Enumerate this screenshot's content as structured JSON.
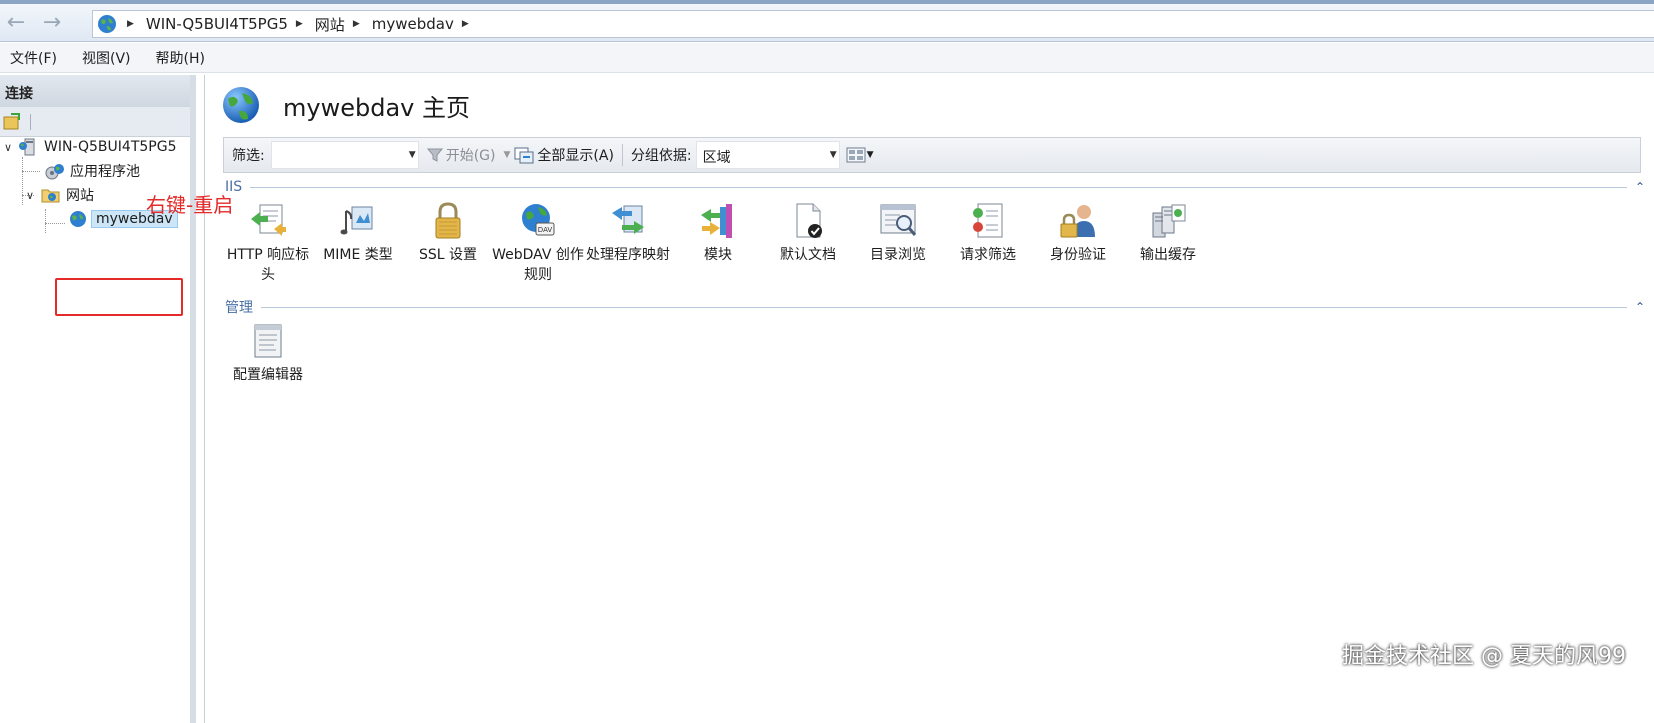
{
  "address": {
    "back_icon": "back-arrow-icon",
    "forward_icon": "forward-arrow-icon",
    "crumbs": [
      "WIN-Q5BUI4T5PG5",
      "网站",
      "mywebdav"
    ]
  },
  "menu": {
    "items": [
      "文件(F)",
      "视图(V)",
      "帮助(H)"
    ]
  },
  "connections": {
    "title": "连接",
    "tree": {
      "server": "WIN-Q5BUI4T5PG5",
      "app_pools": "应用程序池",
      "sites": "网站",
      "selected_site": "mywebdav"
    }
  },
  "annotation": {
    "text": "右键-重启",
    "color": "#e52a2a"
  },
  "main": {
    "title": "mywebdav 主页",
    "filter": {
      "label": "筛选:",
      "value": "",
      "start_label": "开始(G)",
      "show_all_label": "全部显示(A)",
      "group_label": "分组依据:",
      "group_value": "区域"
    },
    "sections": [
      {
        "title": "IIS",
        "features": [
          {
            "label": "HTTP 响应标头",
            "icon": "http-response-headers-icon"
          },
          {
            "label": "MIME 类型",
            "icon": "mime-types-icon"
          },
          {
            "label": "SSL 设置",
            "icon": "ssl-lock-icon"
          },
          {
            "label": "WebDAV 创作规则",
            "icon": "webdav-authoring-icon"
          },
          {
            "label": "处理程序映射",
            "icon": "handler-mappings-icon"
          },
          {
            "label": "模块",
            "icon": "modules-icon"
          },
          {
            "label": "默认文档",
            "icon": "default-document-icon"
          },
          {
            "label": "目录浏览",
            "icon": "directory-browsing-icon"
          },
          {
            "label": "请求筛选",
            "icon": "request-filtering-icon"
          },
          {
            "label": "身份验证",
            "icon": "authentication-icon"
          },
          {
            "label": "输出缓存",
            "icon": "output-caching-icon"
          }
        ]
      },
      {
        "title": "管理",
        "features": [
          {
            "label": "配置编辑器",
            "icon": "configuration-editor-icon"
          }
        ]
      }
    ]
  },
  "watermark": "掘金技术社区 @ 夏天的风99"
}
